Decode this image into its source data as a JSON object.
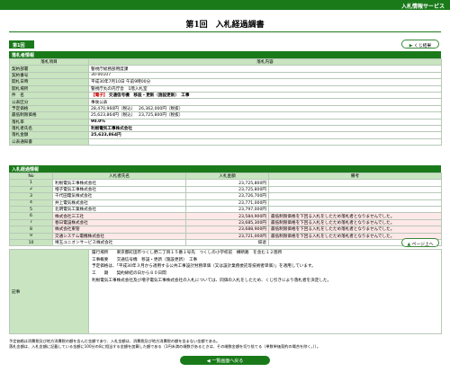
{
  "header": {
    "service_name": "入札情報サービス"
  },
  "page_title": "第1回　入札経過調書",
  "round_tab": "第1回",
  "back_button": "くじ結果",
  "list_button": "ページ上へ",
  "bottom_back_button": "一覧画面へ戻る",
  "sections": {
    "info": "落札者情報",
    "bids": "入札経過情報"
  },
  "info_headers": {
    "item": "落札項目",
    "content": "落札内容"
  },
  "info_rows": [
    {
      "label": "契約部署",
      "value": "警視庁総務部用度課"
    },
    {
      "label": "契約番号",
      "value": "30-00107"
    },
    {
      "label": "開札日時",
      "value": "平成30年7月10日 午前9時00分"
    },
    {
      "label": "開札場所",
      "value": "警視庁丸の内庁舎　1階入札室"
    }
  ],
  "subject": {
    "label": "件　名",
    "tag": "【電子】",
    "text": "交通信号機　移設・更新（施設更新）　工事"
  },
  "info_rows2": [
    {
      "label": "公表区分",
      "value": "事後公表"
    }
  ],
  "estimate": {
    "label": "予定価格",
    "tax_incl": "28,470,960円（税込）",
    "tax_excl": "26,362,000円（税抜）"
  },
  "minimum": {
    "label": "最低制限価格",
    "tax_incl": "25,623,864円（税込）",
    "tax_excl": "23,725,800円（税抜）"
  },
  "info_rows3": [
    {
      "label": "落札率",
      "value": "90.0%"
    },
    {
      "label": "落札者氏名",
      "value": "利根電気工事株式会社"
    },
    {
      "label": "落札金額",
      "value": "25,623,864円"
    },
    {
      "label": "公表通知書",
      "value": ""
    }
  ],
  "bid_headers": {
    "no": "No",
    "bidder": "入札者氏名",
    "amount": "入札金額",
    "note": "備考"
  },
  "bids": [
    {
      "no": "1",
      "bidder": "利根電気工事株式会社",
      "amount": "23,725,800円",
      "note": ""
    },
    {
      "no": "2",
      "bidder": "増子電気工事株式会社",
      "amount": "23,725,800円",
      "note": ""
    },
    {
      "no": "3",
      "bidder": "千代田電気株式会社",
      "amount": "23,726,700円",
      "note": ""
    },
    {
      "no": "4",
      "bidder": "井上電気株式会社",
      "amount": "23,771,000円",
      "note": ""
    },
    {
      "no": "5",
      "bidder": "北明電気工業株式会社",
      "amount": "23,797,000円",
      "note": ""
    },
    {
      "no": "6",
      "bidder": "株式会社三工社",
      "amount": "23,584,900円",
      "note": "最低制限価格を下回る入札をしたため落札者となりませんでした。"
    },
    {
      "no": "7",
      "bidder": "春日電設株式会社",
      "amount": "23,685,300円",
      "note": "最低制限価格を下回る入札をしたため落札者となりませんでした。"
    },
    {
      "no": "8",
      "bidder": "株式会社東管",
      "amount": "23,688,900円",
      "note": "最低制限価格を下回る入札をしたため落札者となりませんでした。"
    },
    {
      "no": "9",
      "bidder": "交通システム電機株式会社",
      "amount": "23,721,000円",
      "note": "最低制限価格を下回る入札をしたため落札者となりませんでした。"
    },
    {
      "no": "10",
      "bidder": "埼玉ユニオンサービス株式会社",
      "amount": "辞退",
      "note": ""
    }
  ],
  "memo": {
    "label": "記事",
    "lines": [
      "履行場所　　東京都町田市つくし野二丁目１５番１号先　つくしの小学校前　横断路　を含む１２箇所",
      "工事概要　　交通信号機　移設・更新（施設更新）　工事",
      "予定価格は、「平成30年３月から適用する公共工事設計労務単価（又は設計業務委託等技術者単価）」を適用しています。",
      "工　　期　　契約締結の日から８０日間",
      "利根電気工事株式会社及び増子電気工事株式会社の入札については、同価の入札をしたため、くじ引きにより落札者を決定した。"
    ]
  },
  "footnotes": [
    "予定価格は消費税及び地方消費税の額を含んだ金額であり、入札金額は、消費税及び地方消費税の額を含まない金額である。",
    "落札金額は、入札金額に記載している金額に100分の8に相当する金額を加算した額である（1円未満の端数があるときは、その端数金額を切り捨てる（単数単価契約の場合を除く。））。"
  ]
}
